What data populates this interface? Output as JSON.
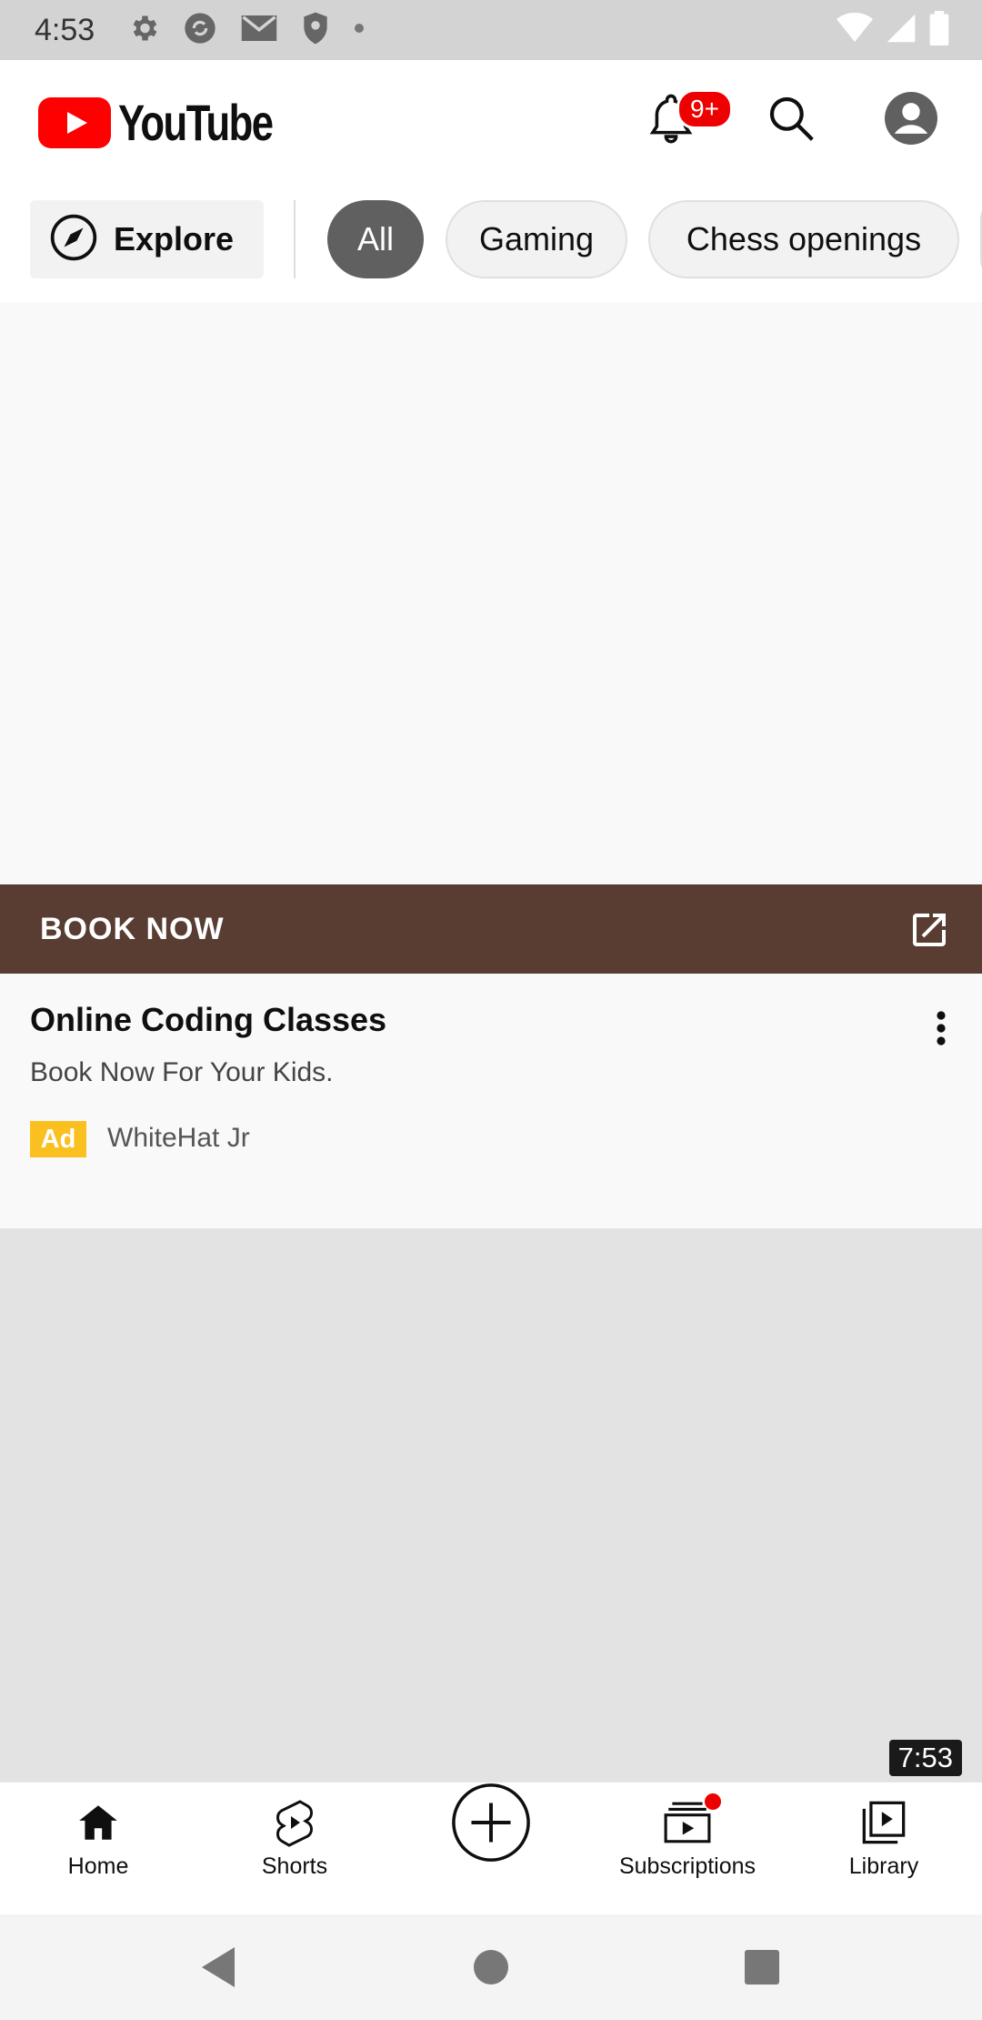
{
  "status_bar": {
    "time": "4:53",
    "left_icons": [
      "settings-icon",
      "sync-icon",
      "gmail-icon",
      "shield-icon",
      "dot-icon"
    ],
    "right_icons": [
      "wifi-icon",
      "signal-icon",
      "battery-icon"
    ]
  },
  "header": {
    "logo_text": "YouTube",
    "notification_badge": "9+",
    "icons": [
      "bell-icon",
      "search-icon",
      "account-icon"
    ]
  },
  "chips": {
    "explore_label": "Explore",
    "items": [
      {
        "label": "All",
        "selected": true
      },
      {
        "label": "Gaming",
        "selected": false
      },
      {
        "label": "Chess openings",
        "selected": false
      }
    ]
  },
  "ad": {
    "cta_label": "BOOK NOW",
    "title": "Online Coding Classes",
    "description": "Book Now For Your Kids.",
    "badge": "Ad",
    "advertiser": "WhiteHat Jr"
  },
  "video": {
    "duration": "7:53"
  },
  "bottom_nav": {
    "items": [
      {
        "label": "Home",
        "icon": "home-icon",
        "active": true
      },
      {
        "label": "Shorts",
        "icon": "shorts-icon",
        "active": false
      },
      {
        "label": "",
        "icon": "create-icon",
        "active": false
      },
      {
        "label": "Subscriptions",
        "icon": "subscriptions-icon",
        "active": false
      },
      {
        "label": "Library",
        "icon": "library-icon",
        "active": false
      }
    ]
  },
  "colors": {
    "brand_red": "#ff0000",
    "cta_bar": "#5a3d32",
    "ad_badge": "#f9c01f",
    "chip_selected": "#606060"
  }
}
